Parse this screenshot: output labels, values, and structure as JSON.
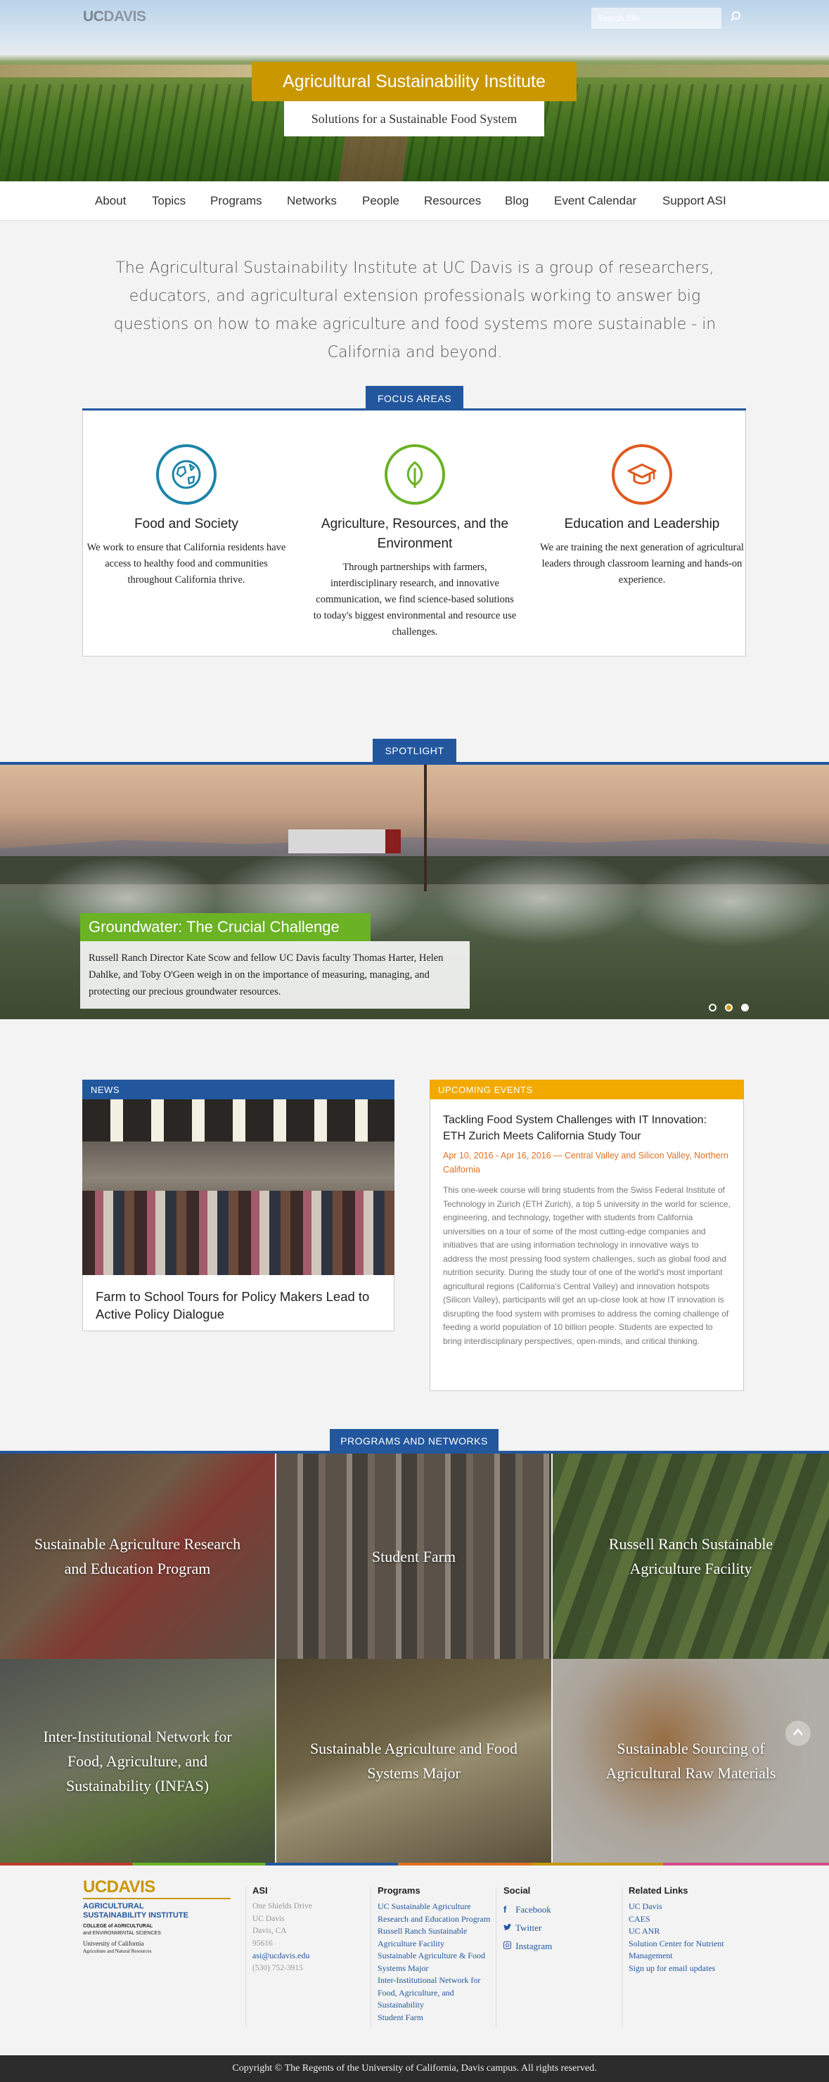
{
  "header": {
    "logo_uc": "UC",
    "logo_davis": "DAVIS",
    "search_placeholder": "Search Site",
    "title": "Agricultural Sustainability Institute",
    "subtitle": "Solutions for a Sustainable Food System"
  },
  "nav": [
    "About",
    "Topics",
    "Programs",
    "Networks",
    "People",
    "Resources",
    "Blog",
    "Event Calendar",
    "Support ASI"
  ],
  "intro": "The Agricultural Sustainability Institute at UC Davis is a group of researchers, educators, and agricultural extension professionals working to answer big questions on how to make agriculture and food systems more sustainable - in California and beyond.",
  "focus": {
    "tab": "FOCUS AREAS",
    "items": [
      {
        "title": "Food and Society",
        "text": "We work to ensure that California residents have access to healthy food and communities throughout California thrive.",
        "icon": "globe-icon",
        "color": "#1a84a8"
      },
      {
        "title": "Agriculture, Resources, and the Environment",
        "text": "Through partnerships with farmers, interdisciplinary research, and innovative communication, we find science-based solutions to today's biggest environmental and resource use challenges.",
        "icon": "leaf-icon",
        "color": "#6bb225"
      },
      {
        "title": "Education and Leadership",
        "text": "We are training the next generation of agricultural leaders through classroom learning and hands-on experience.",
        "icon": "graduation-cap-icon",
        "color": "#e05a1e"
      }
    ]
  },
  "spotlight": {
    "tab": "SPOTLIGHT",
    "title": "Groundwater: The Crucial Challenge",
    "text": "Russell Ranch Director Kate Scow and fellow UC Davis faculty Thomas Harter, Helen Dahlke, and Toby O'Geen weigh in on the importance of measuring, managing, and protecting our precious groundwater resources.",
    "slides": 3,
    "active_slide": 2
  },
  "news": {
    "label": "NEWS",
    "title": "Farm to School Tours for Policy Makers Lead to Active Policy Dialogue"
  },
  "events": {
    "label": "UPCOMING EVENTS",
    "title": "Tackling Food System Challenges with IT Innovation: ETH Zurich Meets California Study Tour",
    "date": "Apr 10, 2016 - Apr 16, 2016 — Central Valley and Silicon Valley, Northern California",
    "text": "This one-week course will bring students from the Swiss Federal Institute of Technology in Zurich (ETH Zurich), a top 5 university in the world for science, engineering, and technology, together with students from California universities on a tour of some of the most cutting-edge companies and initiatives that are using information technology in innovative ways to address the most pressing food system challenges, such as global food and nutrition security. During the study tour of one of the world's most important agricultural regions (California's Central Valley) and innovation hotspots (Silicon Valley), participants will get an up-close look at how IT innovation is disrupting the food system with promises to address the coming challenge of feeding a world population of 10 billion people. Students are expected to bring interdisciplinary perspectives, open-minds, and critical thinking."
  },
  "programs": {
    "tab": "PROGRAMS AND NETWORKS",
    "items": [
      "Sustainable Agriculture Research and Education Program",
      "Student Farm",
      "Russell Ranch Sustainable Agriculture Facility",
      "Inter-Institutional Network for Food, Agriculture, and Sustainability (INFAS)",
      "Sustainable Agriculture and Food Systems Major",
      "Sustainable Sourcing of Agricultural Raw Materials"
    ]
  },
  "footer": {
    "logo_uc": "UC",
    "logo_davis": "DAVIS",
    "logo_line1": "AGRICULTURAL",
    "logo_line2": "SUSTAINABILITY INSTITUTE",
    "logo_line3": "COLLEGE of AGRICULTURAL",
    "logo_line4": "and ENVIRONMENTAL SCIENCES",
    "logo_line5": "University of California",
    "logo_line6": "Agriculture and Natural Resources",
    "asi_title": "ASI",
    "address": [
      "One Shields Drive",
      "UC Davis",
      "Davis, CA",
      "95616"
    ],
    "email": "asi@ucdavis.edu",
    "phone": "(530) 752-3915",
    "programs_title": "Programs",
    "programs": [
      "UC Sustainable Agriculture Research and Education Program",
      "Russell Ranch Sustainable Agriculture Facility",
      "Sustainable Agriculture & Food Systems Major",
      "Inter-Institutional Network for Food, Agriculture, and Sustainability",
      "Student Farm"
    ],
    "social_title": "Social",
    "social": [
      "Facebook",
      "Twitter",
      "Instagram"
    ],
    "related_title": "Related Links",
    "related": [
      "UC Davis",
      "CAES",
      "UC ANR",
      "Solution Center for Nutrient Management",
      "Sign up for email updates"
    ],
    "copyright": "Copyright © The Regents of the University of California, Davis campus. All rights reserved."
  }
}
